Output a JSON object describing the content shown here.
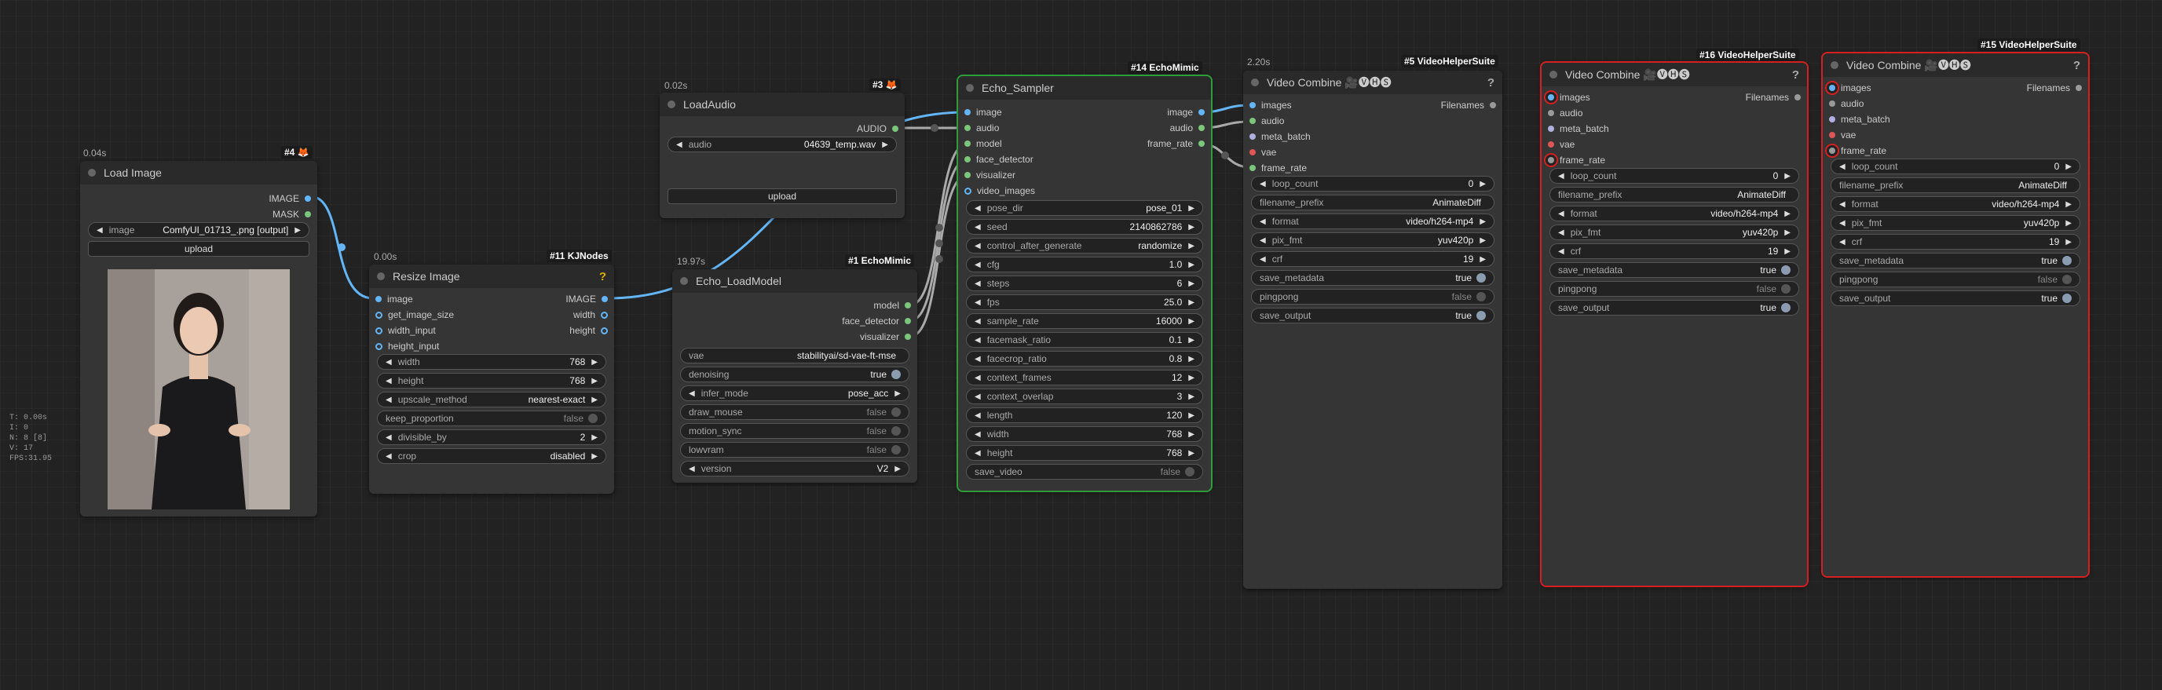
{
  "stats": {
    "t": "T: 0.00s",
    "i": "I: 0",
    "n": "N: 8 [8]",
    "v": "V: 17",
    "fps": "FPS:31.95"
  },
  "load_image": {
    "time": "0.04s",
    "badge_id": "#4",
    "badge_icon": "🦊",
    "title": "Load Image",
    "outputs": [
      "IMAGE",
      "MASK"
    ],
    "image_label": "image",
    "image_value": "ComfyUI_01713_.png [output]",
    "upload": "upload"
  },
  "resize_image": {
    "time": "0.00s",
    "badge": "#11 KJNodes",
    "title": "Resize Image",
    "help": "?",
    "inputs": [
      "image",
      "get_image_size",
      "width_input",
      "height_input"
    ],
    "outputs": [
      "IMAGE",
      "width",
      "height"
    ],
    "widgets": [
      {
        "label": "width",
        "value": "768"
      },
      {
        "label": "height",
        "value": "768"
      },
      {
        "label": "upscale_method",
        "value": "nearest-exact"
      },
      {
        "label": "keep_proportion",
        "value": "false"
      },
      {
        "label": "divisible_by",
        "value": "2"
      },
      {
        "label": "crop",
        "value": "disabled"
      }
    ]
  },
  "load_audio": {
    "time": "0.02s",
    "badge_id": "#3",
    "badge_icon": "🦊",
    "title": "LoadAudio",
    "output": "AUDIO",
    "audio_label": "audio",
    "audio_value": "04639_temp.wav",
    "upload": "upload"
  },
  "echo_loadmodel": {
    "time": "19.97s",
    "badge": "#1 EchoMimic",
    "title": "Echo_LoadModel",
    "outputs": [
      "model",
      "face_detector",
      "visualizer"
    ],
    "widgets": [
      {
        "label": "vae",
        "value": "stabilityai/sd-vae-ft-mse"
      },
      {
        "label": "denoising",
        "value": "true"
      },
      {
        "label": "infer_mode",
        "value": "pose_acc"
      },
      {
        "label": "draw_mouse",
        "value": "false"
      },
      {
        "label": "motion_sync",
        "value": "false"
      },
      {
        "label": "lowvram",
        "value": "false"
      },
      {
        "label": "version",
        "value": "V2"
      }
    ]
  },
  "echo_sampler": {
    "badge": "#14 EchoMimic",
    "title": "Echo_Sampler",
    "inputs": [
      "image",
      "audio",
      "model",
      "face_detector",
      "visualizer",
      "video_images"
    ],
    "outputs": [
      "image",
      "audio",
      "frame_rate"
    ],
    "widgets": [
      {
        "label": "pose_dir",
        "value": "pose_01"
      },
      {
        "label": "seed",
        "value": "2140862786"
      },
      {
        "label": "control_after_generate",
        "value": "randomize"
      },
      {
        "label": "cfg",
        "value": "1.0"
      },
      {
        "label": "steps",
        "value": "6"
      },
      {
        "label": "fps",
        "value": "25.0"
      },
      {
        "label": "sample_rate",
        "value": "16000"
      },
      {
        "label": "facemask_ratio",
        "value": "0.1"
      },
      {
        "label": "facecrop_ratio",
        "value": "0.8"
      },
      {
        "label": "context_frames",
        "value": "12"
      },
      {
        "label": "context_overlap",
        "value": "3"
      },
      {
        "label": "length",
        "value": "120"
      },
      {
        "label": "width",
        "value": "768"
      },
      {
        "label": "height",
        "value": "768"
      },
      {
        "label": "save_video",
        "value": "false"
      }
    ]
  },
  "video_combine_5": {
    "time": "2.20s",
    "badge": "#5 VideoHelperSuite",
    "title": "Video Combine 🎥🅥🅗🅢",
    "help": "?",
    "inputs": [
      "images",
      "audio",
      "meta_batch",
      "vae",
      "frame_rate"
    ],
    "output": "Filenames",
    "widgets": [
      {
        "label": "loop_count",
        "value": "0"
      },
      {
        "label": "filename_prefix",
        "value": "AnimateDiff"
      },
      {
        "label": "format",
        "value": "video/h264-mp4"
      },
      {
        "label": "pix_fmt",
        "value": "yuv420p"
      },
      {
        "label": "crf",
        "value": "19"
      },
      {
        "label": "save_metadata",
        "value": "true"
      },
      {
        "label": "pingpong",
        "value": "false"
      },
      {
        "label": "save_output",
        "value": "true"
      }
    ]
  },
  "video_combine_16": {
    "badge": "#16 VideoHelperSuite",
    "title": "Video Combine 🎥🅥🅗🅢",
    "help": "?",
    "inputs": [
      "images",
      "audio",
      "meta_batch",
      "vae",
      "frame_rate"
    ],
    "output": "Filenames",
    "widgets": [
      {
        "label": "loop_count",
        "value": "0"
      },
      {
        "label": "filename_prefix",
        "value": "AnimateDiff"
      },
      {
        "label": "format",
        "value": "video/h264-mp4"
      },
      {
        "label": "pix_fmt",
        "value": "yuv420p"
      },
      {
        "label": "crf",
        "value": "19"
      },
      {
        "label": "save_metadata",
        "value": "true"
      },
      {
        "label": "pingpong",
        "value": "false"
      },
      {
        "label": "save_output",
        "value": "true"
      }
    ]
  },
  "video_combine_15": {
    "badge": "#15 VideoHelperSuite",
    "title": "Video Combine 🎥🅥🅗🅢",
    "help": "?",
    "inputs": [
      "images",
      "audio",
      "meta_batch",
      "vae",
      "frame_rate"
    ],
    "output": "Filenames",
    "widgets": [
      {
        "label": "loop_count",
        "value": "0"
      },
      {
        "label": "filename_prefix",
        "value": "AnimateDiff"
      },
      {
        "label": "format",
        "value": "video/h264-mp4"
      },
      {
        "label": "pix_fmt",
        "value": "yuv420p"
      },
      {
        "label": "crf",
        "value": "19"
      },
      {
        "label": "save_metadata",
        "value": "true"
      },
      {
        "label": "pingpong",
        "value": "false"
      },
      {
        "label": "save_output",
        "value": "true"
      }
    ]
  }
}
